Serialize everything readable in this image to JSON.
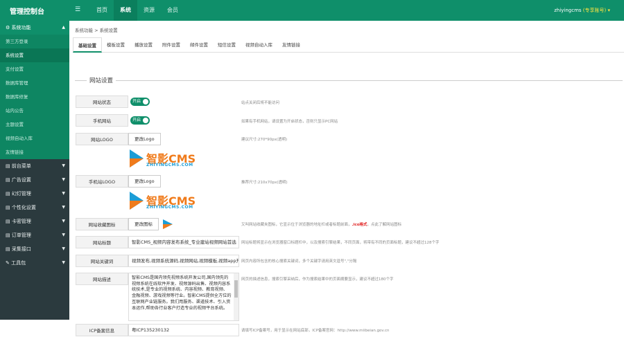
{
  "header": {
    "brand": "管理控制台",
    "menu_icon": "☰",
    "nav": [
      "首页",
      "系统",
      "资源",
      "会员"
    ],
    "user_name": "zhiyingcms",
    "user_badge": "(专享账号)",
    "user_caret": "▾"
  },
  "sidebar": {
    "open_group": "⚙ 系统功能",
    "sub_items": [
      "第三方登录",
      "系统设置",
      "支付设置",
      "数据库管理",
      "数据库修复",
      "站内公告",
      "主题设置",
      "视频自动入库",
      "友情链接"
    ],
    "active_sub": 1,
    "groups": [
      "▤ 前台菜单",
      "▤ 广告设置",
      "▤ 幻灯管理",
      "▤ 个性化设置",
      "▤ 卡密管理",
      "▤ 订单管理",
      "▤ 采集接口",
      "✎ 工具包"
    ]
  },
  "breadcrumb": "系统功能  >  系统设置",
  "tabs": [
    "基础设置",
    "模板设置",
    "播放设置",
    "附件设置",
    "邮件设置",
    "短信设置",
    "视频自动入库",
    "友情链接"
  ],
  "active_tab": 0,
  "section_title": "网站设置",
  "form": {
    "site_status": {
      "label": "网站状态",
      "switch": "开启",
      "hint": "站点关闭后将不能访问"
    },
    "mobile_site": {
      "label": "手机网站",
      "switch": "开启",
      "hint": "如果有手机网站，请设置为开启状态，否则只显示PC网站"
    },
    "site_logo": {
      "label": "网站LOGO",
      "button": "更改Logo",
      "hint": "建议尺寸:270*90px(透明)"
    },
    "mobile_logo": {
      "label": "手机站LOGO",
      "button": "更改Logo",
      "hint": "推荐尺寸:210x70px(透明)"
    },
    "favicon": {
      "label": "网站收藏图标",
      "button": "更改图标",
      "hint_a": "又叫网站收藏夹图标，它显示位于浏览器的地址栏或者标题前面，",
      "hint_red": ".ico格式",
      "hint_b": "，点此了解网站图标"
    },
    "site_title": {
      "label": "网站标题",
      "value": "智影CMS_视频内容发布系统_专业建站视频网站首选",
      "hint": "网站标题将显示在浏览器窗口标题栏中，以及搜索引擎结果，不同页面，将带有不同的页面标题，建议不超过128个字"
    },
    "keywords": {
      "label": "网站关键词",
      "value": "视频发布,视频系统源码,视频网站,视频模板,视频app开发",
      "hint": "网页内容所包含的核心搜索关键词，多个关键字请用英文逗号\",\"分隔"
    },
    "description": {
      "label": "网站描述",
      "value": "智影CMS是国内领先视频系统开发公司,国内领先的视频系统在线软件开发、视频源码出售、视频内容系统技术,是专业的视频系统、内容视频、教育视频、金融视频、游戏视频等行业。智影CMS提供全方位的互联网产业链服务。我们用服务、渠道技术、引入资本运作,帮助各行业客户打造专业的视频平台系统。",
      "hint": "网页的描述信息，搜索引擎采纳后，作为搜索结果中的页面摘要显示，建议不超过180个字"
    },
    "icp": {
      "label": "ICP备案信息",
      "value": "粤ICP135230132",
      "hint": "请填写ICP备案号，用于显示在网站底部，ICP备案官网：http://www.miibeian.gov.cn"
    }
  },
  "logo": {
    "text": "智影CMS",
    "sub": "ZHIYINGCMS.COM",
    "icon_color": "#1c9dd6",
    "text_color": "#f07b1b"
  },
  "colors": {
    "primary": "#0f8f6a",
    "sidebar": "#2b3a3e"
  }
}
